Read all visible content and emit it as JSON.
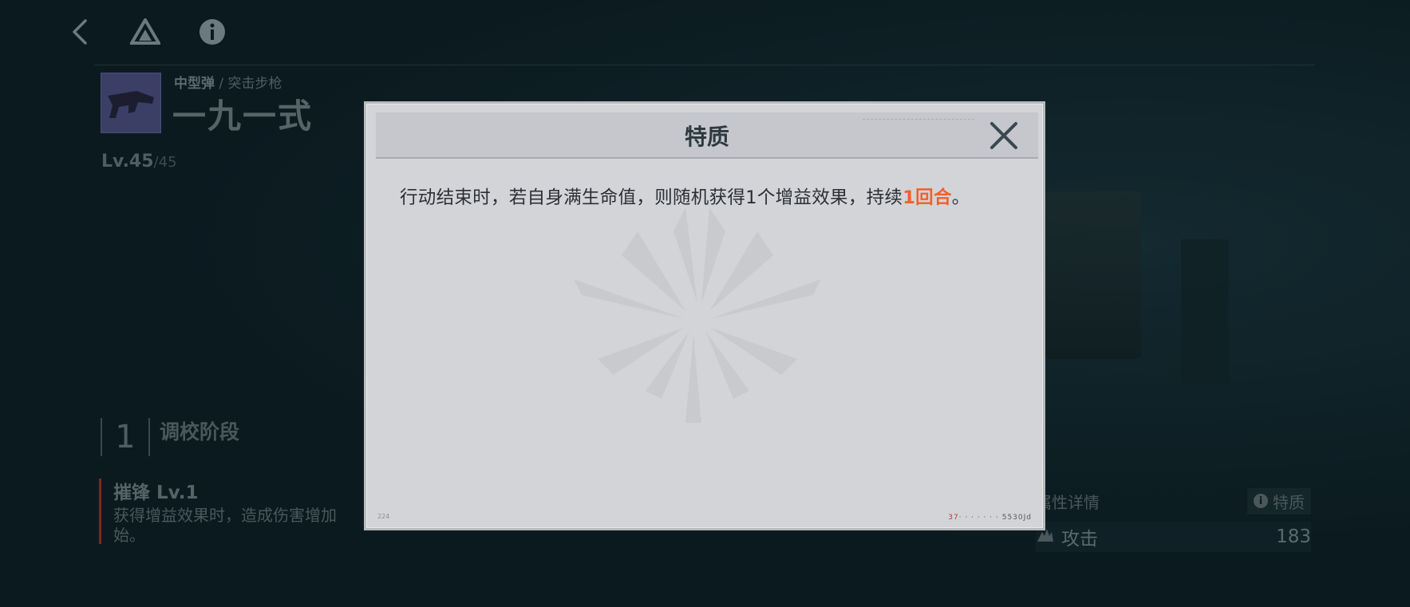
{
  "weapon": {
    "ammo_type": "中型弹",
    "category": "突击步枪",
    "separator": " / ",
    "name": "一九一式",
    "level_label": "Lv.45",
    "level_max": "/45"
  },
  "stage": {
    "number": "1",
    "label": "调校阶段"
  },
  "skill": {
    "title": "摧锋 Lv.1",
    "description": "获得增益效果时，造成伤害增加",
    "description_cont": "始。"
  },
  "attributes": {
    "header": "属性详情",
    "trait_tag": "特质",
    "trait_icon": "i",
    "rows": [
      {
        "name": "攻击",
        "value": "183"
      }
    ]
  },
  "modal": {
    "title": "特质",
    "text_before": "行动结束时，若自身满生命值，则随机获得1个增益效果，持续",
    "text_highlight": "1回合",
    "text_after": "。",
    "highlight_color": "#f0602a",
    "footer_left": "224",
    "footer_right_red": "37",
    "footer_right": "· · · · · · · 5530Jd"
  },
  "icons": {
    "back": "back-arrow-icon",
    "rank": "triangle-rank-icon",
    "info": "info-icon",
    "close": "close-icon",
    "attack": "attack-icon"
  }
}
